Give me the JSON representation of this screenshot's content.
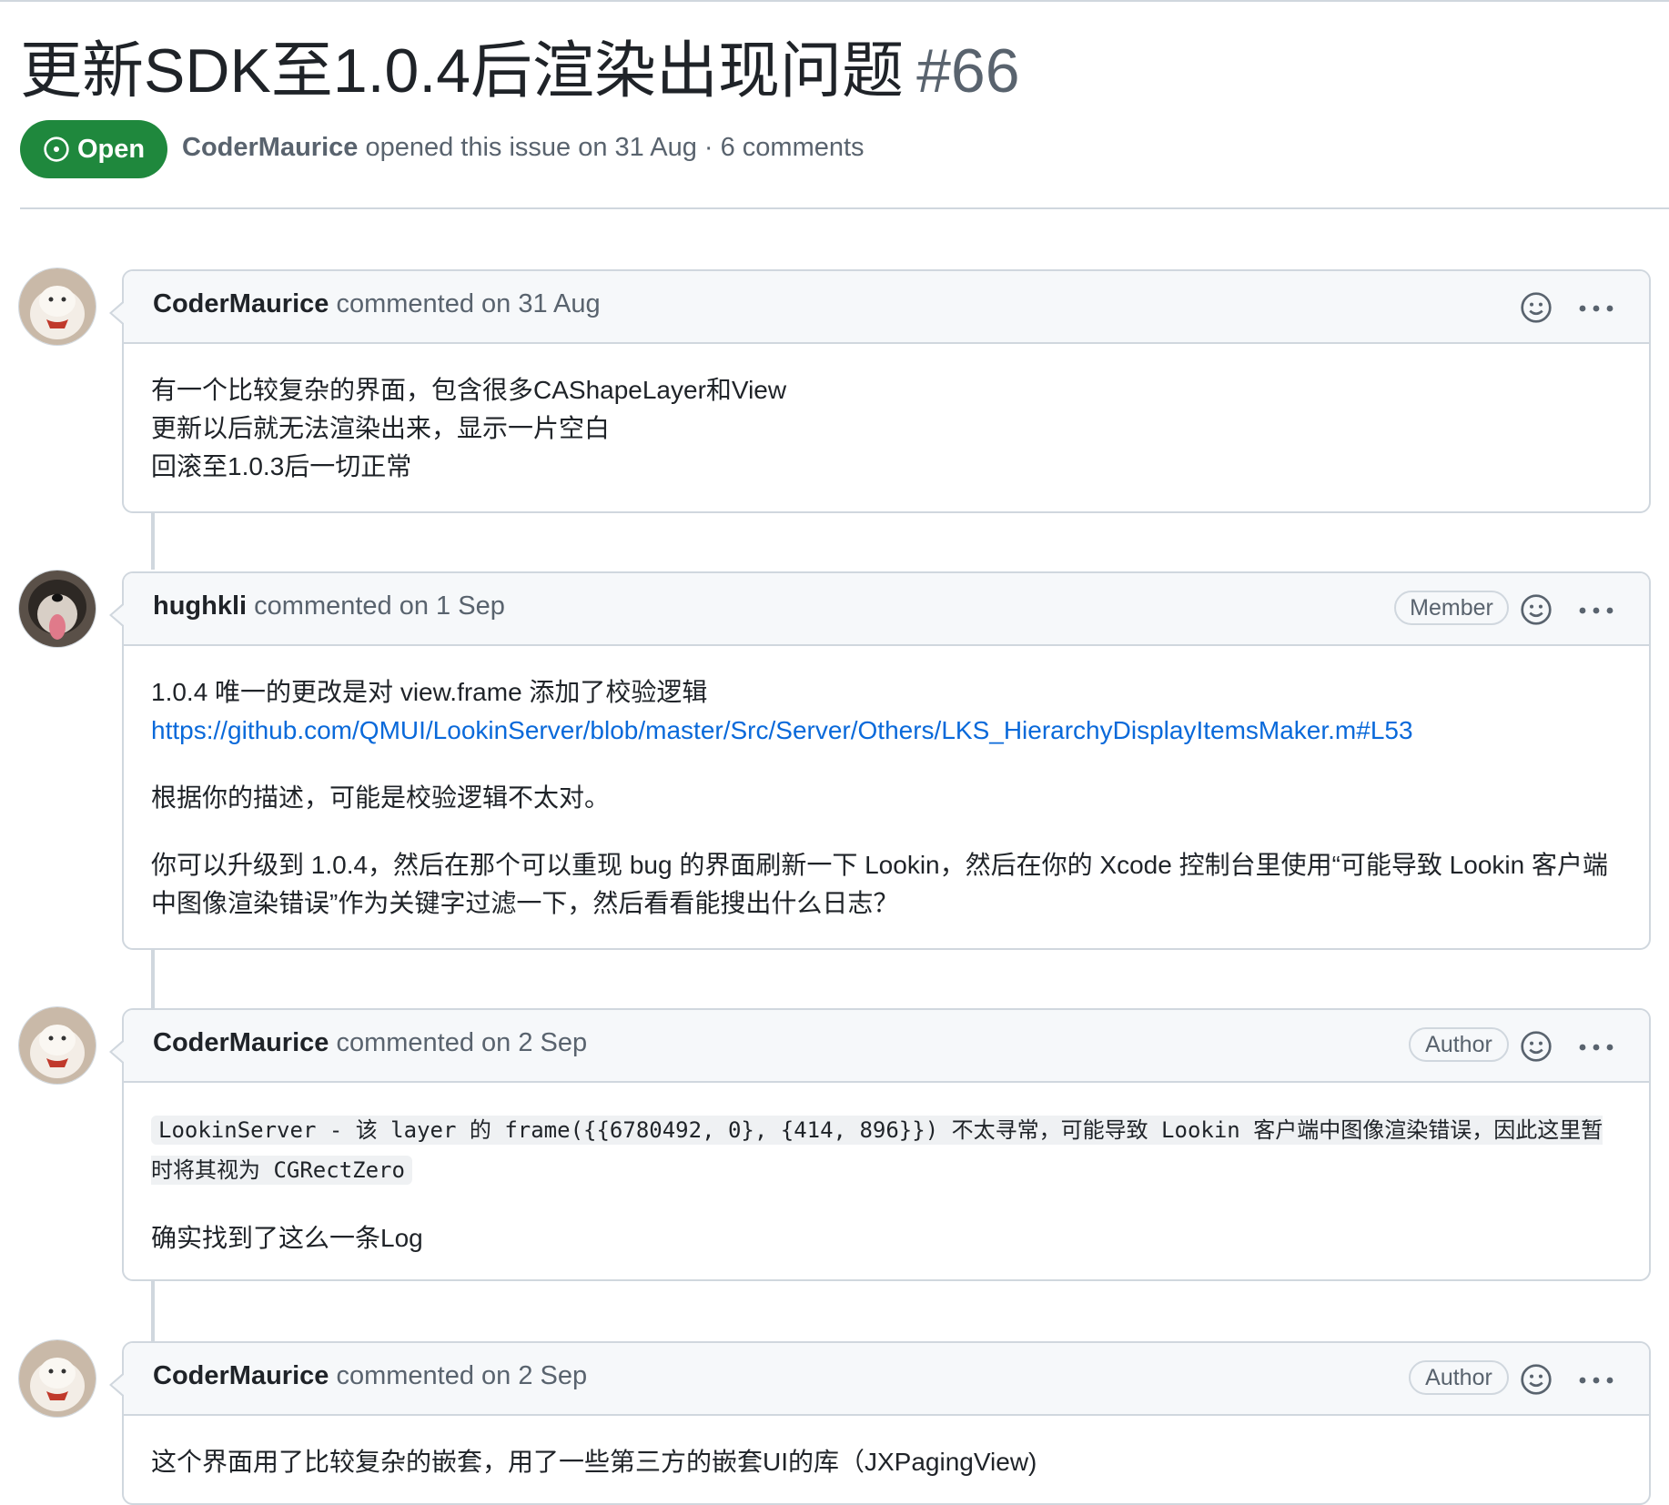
{
  "issue": {
    "title": "更新SDK至1.0.4后渲染出现问题",
    "number": "#66",
    "state": "Open",
    "author": "CoderMaurice",
    "meta_text": " opened this issue on 31 Aug · 6 comments"
  },
  "comments": [
    {
      "author": "CoderMaurice",
      "date_text": " commented on 31 Aug",
      "role": "",
      "lines": [
        "有一个比较复杂的界面，包含很多CAShapeLayer和View",
        "更新以后就无法渲染出来，显示一片空白",
        "回滚至1.0.3后一切正常"
      ]
    },
    {
      "author": "hughkli",
      "date_text": " commented on 1 Sep",
      "role": "Member",
      "line1": "1.0.4 唯一的更改是对 view.frame 添加了校验逻辑",
      "link": "https://github.com/QMUI/LookinServer/blob/master/Src/Server/Others/LKS_HierarchyDisplayItemsMaker.m#L53",
      "para2": "根据你的描述，可能是校验逻辑不太对。",
      "para3": "你可以升级到 1.0.4，然后在那个可以重现 bug 的界面刷新一下 Lookin，然后在你的 Xcode 控制台里使用“可能导致 Lookin 客户端中图像渲染错误”作为关键字过滤一下，然后看看能搜出什么日志？"
    },
    {
      "author": "CoderMaurice",
      "date_text": " commented on 2 Sep",
      "role": "Author",
      "code": "LookinServer - 该 layer 的 frame({{6780492, 0}, {414, 896}}) 不太寻常，可能导致 Lookin 客户端中图像渲染错误，因此这里暂时将其视为 CGRectZero",
      "para2": "确实找到了这么一条Log"
    },
    {
      "author": "CoderMaurice",
      "date_text": " commented on 2 Sep",
      "role": "Author",
      "line1": "这个界面用了比较复杂的嵌套，用了一些第三方的嵌套UI的库（JXPagingView)"
    }
  ],
  "colors": {
    "open_green": "#1f883d",
    "link_blue": "#0969da",
    "border": "#d0d7de"
  }
}
